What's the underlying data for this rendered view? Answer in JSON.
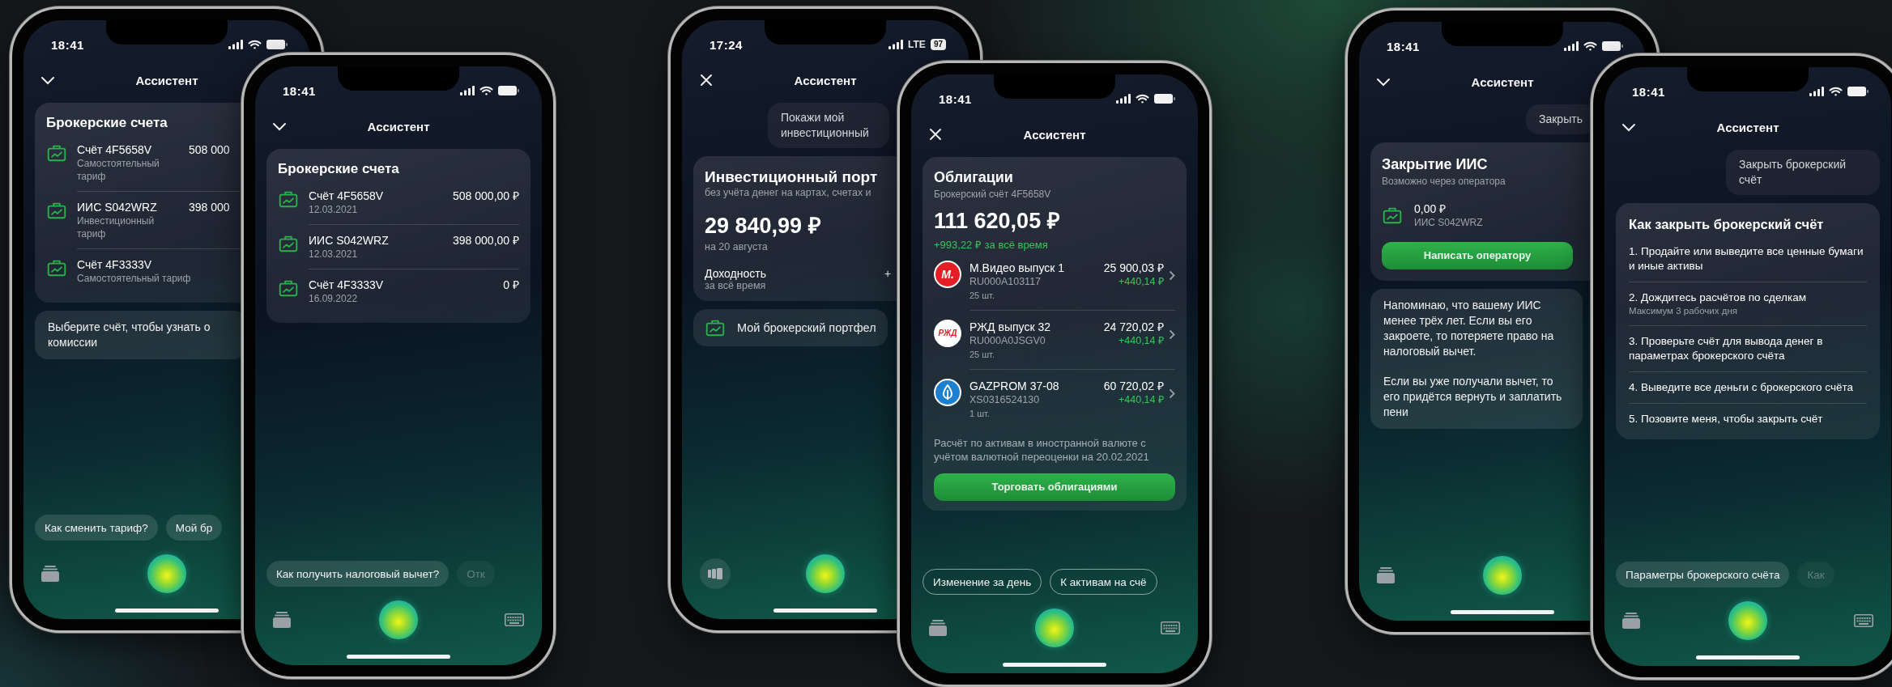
{
  "phones": [
    {
      "status": {
        "time": "18:41",
        "kind": "wifi"
      },
      "header": {
        "kind": "chevron",
        "title": "Ассистент"
      },
      "blocks": [
        {
          "kind": "accounts",
          "title": "Брокерские счета",
          "rows": [
            {
              "name": "Счёт 4F5658V",
              "detail": "Самостоятельный тариф",
              "amount": "508 000"
            },
            {
              "name": "ИИС S042WRZ",
              "detail": "Инвестиционный тариф",
              "amount": "398 000"
            },
            {
              "name": "Счёт 4F3333V",
              "detail": "Самостоятельный тариф"
            }
          ]
        },
        {
          "kind": "bot_text",
          "paragraphs": [
            "Выберите счёт, чтобы узнать о комиссии"
          ]
        }
      ],
      "chips": [
        {
          "kind": "filled",
          "label": "Как сменить тариф?",
          "faded": false
        },
        {
          "kind": "filled",
          "label": "Мой бр",
          "faded": false
        }
      ],
      "toolbar": {
        "left": {
          "kind": "stack"
        }
      }
    },
    {
      "status": {
        "time": "18:41",
        "kind": "wifi"
      },
      "header": {
        "kind": "chevron",
        "title": "Ассистент"
      },
      "blocks": [
        {
          "kind": "accounts",
          "title": "Брокерские счета",
          "rows": [
            {
              "name": "Счёт 4F5658V",
              "detail": "12.03.2021",
              "amount": "508 000,00 ₽"
            },
            {
              "name": "ИИС S042WRZ",
              "detail": "12.03.2021",
              "amount": "398 000,00 ₽"
            },
            {
              "name": "Счёт 4F3333V",
              "detail": "16.09.2022",
              "amount": "0 ₽"
            }
          ]
        }
      ],
      "chips": [
        {
          "kind": "filled",
          "label": "Как получить налоговый вычет?",
          "faded": false
        },
        {
          "kind": "filled",
          "label": "Отк",
          "faded": true
        }
      ],
      "toolbar": {
        "left": {
          "kind": "stack"
        },
        "keyboard": true
      }
    },
    {
      "status": {
        "time": "17:24",
        "kind": "lte",
        "network": "LTE",
        "battery": "97"
      },
      "header": {
        "kind": "cross",
        "title": "Ассистент"
      },
      "blocks": [
        {
          "kind": "user",
          "text": "Покажи мой инвестиционный"
        },
        {
          "kind": "portfolio",
          "title": "Инвестиционный порт",
          "subtitle": "без учёта денег на картах, счетах и",
          "amount": "29 840,99 ₽",
          "date": "на 20 августа",
          "yield_label": "Доходность",
          "yield_period": "за всё время",
          "yield_value": "+"
        },
        {
          "kind": "link",
          "label": "Мой брокерский портфел"
        }
      ],
      "toolbar": {
        "left": {
          "kind": "cards"
        }
      }
    },
    {
      "status": {
        "time": "18:41",
        "kind": "wifi"
      },
      "header": {
        "kind": "cross",
        "title": "Ассистент"
      },
      "blocks": [
        {
          "kind": "bonds",
          "title": "Облигации",
          "subtitle": "Брокерский счёт 4F5658V",
          "amount": "111 620,05 ₽",
          "gain": "+993,22 ₽ за всё время",
          "items": [
            {
              "logo": {
                "kind": "letters",
                "text": "М.",
                "color": "#e31e24"
              },
              "name": "М.Видео выпуск 1",
              "isin": "RU000A103117",
              "quantity": "25 шт.",
              "value": "25 900,03 ₽",
              "change": "+440,14 ₽"
            },
            {
              "logo": {
                "kind": "letters_on_light",
                "text": "РЖД",
                "color": "#e31e24"
              },
              "name": "РЖД выпуск 32",
              "isin": "RU000A0JSGV0",
              "quantity": "25 шт.",
              "value": "24 720,02 ₽",
              "change": "+440,14 ₽"
            },
            {
              "logo": {
                "kind": "flame",
                "color": "#1d7fd0"
              },
              "name": "GAZPROM 37-08",
              "isin": "XS0316524130",
              "quantity": "1 шт.",
              "value": "60 720,02 ₽",
              "change": "+440,14 ₽"
            }
          ],
          "note": "Расчёт по активам в иностранной валюте с учётом валютной переоценки на 20.02.2021",
          "button": "Торговать облигациями"
        }
      ],
      "chips": [
        {
          "kind": "outlined",
          "label": "Изменение за день",
          "faded": false
        },
        {
          "kind": "outlined",
          "label": "К активам на счё",
          "faded": false
        }
      ],
      "toolbar": {
        "left": {
          "kind": "stack"
        },
        "keyboard": true
      }
    },
    {
      "status": {
        "time": "18:41",
        "kind": "wifi"
      },
      "header": {
        "kind": "chevron",
        "title": "Ассистент"
      },
      "blocks": [
        {
          "kind": "user",
          "text": "Закрыть"
        },
        {
          "kind": "closing",
          "title": "Закрытие ИИС",
          "subtitle": "Возможно через оператора",
          "amount": "0,00 ₽",
          "account": "ИИС S042WRZ",
          "button": "Написать оператору"
        },
        {
          "kind": "bot_text",
          "paragraphs": [
            "Напоминаю, что вашему ИИС менее трёх лет. Если вы его закроете, то потеряете право на налоговый вычет.",
            "Если вы уже получали вычет, то его придётся вернуть и заплатить пени"
          ]
        }
      ],
      "toolbar": {
        "left": {
          "kind": "stack"
        }
      }
    },
    {
      "status": {
        "time": "18:41",
        "kind": "wifi"
      },
      "header": {
        "kind": "chevron",
        "title": "Ассистент"
      },
      "blocks": [
        {
          "kind": "user",
          "text": "Закрыть брокерский счёт"
        },
        {
          "kind": "steps",
          "title": "Как закрыть брокерский счёт",
          "steps": [
            {
              "text": "1. Продайте или выведите все ценные бумаги и иные активы"
            },
            {
              "text": "2. Дождитесь расчётов по сделкам",
              "note": "Максимум 3 рабочих дня"
            },
            {
              "text": "3. Проверьте счёт для вывода денег в параметрах брокерского счёта"
            },
            {
              "text": "4. Выведите все деньги с брокерского счёта"
            },
            {
              "text": "5. Позовите меня, чтобы закрыть счёт"
            }
          ]
        }
      ],
      "chips": [
        {
          "kind": "filled",
          "label": "Параметры брокерского счёта",
          "faded": false
        },
        {
          "kind": "filled",
          "label": "Как",
          "faded": true
        }
      ],
      "toolbar": {
        "left": {
          "kind": "stack"
        },
        "keyboard": true
      }
    }
  ]
}
